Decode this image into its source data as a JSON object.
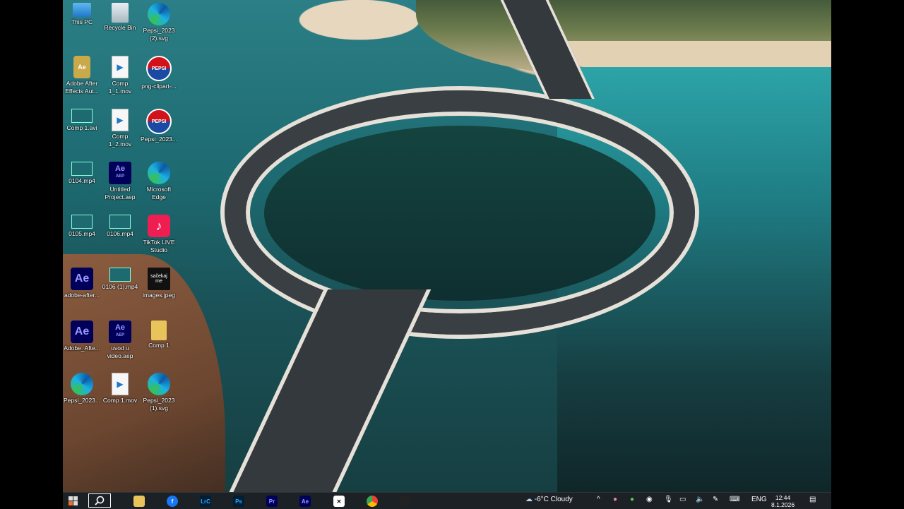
{
  "desktop_icons": [
    {
      "label": "This PC",
      "icon": "this-pc-icon"
    },
    {
      "label": "Recycle Bin",
      "icon": "recycle-bin-icon"
    },
    {
      "label": "Pepsi_2023 (2).svg",
      "icon": "edge-icon"
    },
    {
      "label": "Adobe After Effects Aut...",
      "icon": "ae-installer-icon"
    },
    {
      "label": "Comp 1_1.mov",
      "icon": "video-file-icon"
    },
    {
      "label": "png-clipart-...",
      "icon": "pepsi-icon"
    },
    {
      "label": "Comp 1.avi",
      "icon": "video-thumb-icon"
    },
    {
      "label": "Comp 1_2.mov",
      "icon": "video-file-icon"
    },
    {
      "label": "Pepsi_2023...",
      "icon": "pepsi-icon"
    },
    {
      "label": "0104.mp4",
      "icon": "video-thumb-icon"
    },
    {
      "label": "Untitled Project.aep",
      "icon": "aep-icon"
    },
    {
      "label": "Microsoft Edge",
      "icon": "edge-icon"
    },
    {
      "label": "0105.mp4",
      "icon": "video-thumb-icon"
    },
    {
      "label": "0106.mp4",
      "icon": "video-thumb-icon"
    },
    {
      "label": "TikTok LIVE Studio",
      "icon": "tiktok-icon"
    },
    {
      "label": "adobe-after...",
      "icon": "ae-icon"
    },
    {
      "label": "0106 (1).mp4",
      "icon": "video-thumb-icon"
    },
    {
      "label": "images.jpeg",
      "icon": "image-file-icon"
    },
    {
      "label": "Adobe_Afte...",
      "icon": "ae-icon"
    },
    {
      "label": "uvod u video.aep",
      "icon": "aep-icon"
    },
    {
      "label": "Comp 1",
      "icon": "folder-icon"
    },
    {
      "label": "Pepsi_2023...",
      "icon": "edge-icon"
    },
    {
      "label": "Comp 1.mov",
      "icon": "video-file-icon"
    },
    {
      "label": "Pepsi_2023 (1).svg",
      "icon": "edge-icon"
    }
  ],
  "icon_text": {
    "ae": "Ae",
    "aep_top": "Ae",
    "aep_bottom": "AEP",
    "pepsi": "PEPSI",
    "images": "sačekaj me",
    "tiktok": "♪"
  },
  "taskbar": {
    "apps": [
      {
        "name": "file-explorer",
        "text": ""
      },
      {
        "name": "facebook",
        "text": "f"
      },
      {
        "name": "lightroom",
        "text": "LrC"
      },
      {
        "name": "photoshop",
        "text": "Ps"
      },
      {
        "name": "premiere",
        "text": "Pr"
      },
      {
        "name": "after-effects",
        "text": "Ae"
      },
      {
        "name": "capcut",
        "text": "✕"
      },
      {
        "name": "chrome",
        "text": ""
      },
      {
        "name": "obs",
        "text": ""
      }
    ],
    "weather": "-6°C  Cloudy",
    "language": "ENG",
    "time": "12:44",
    "date": "8.1.2026"
  },
  "colors": {
    "taskbar_bg": "#1c2126",
    "ae_purple": "#00005b",
    "ae_accent": "#9999ff"
  }
}
